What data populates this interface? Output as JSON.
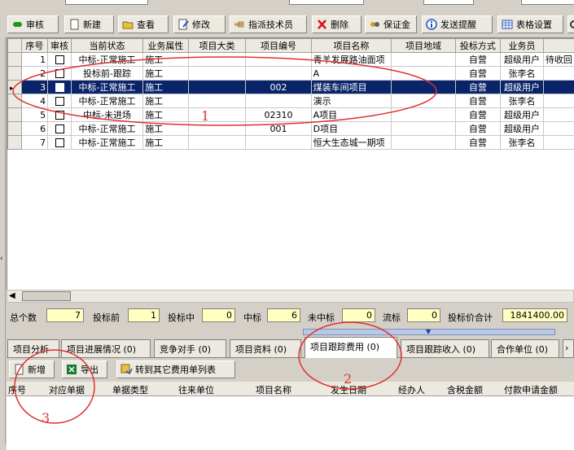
{
  "toolbar": [
    {
      "name": "audit-button",
      "label": "审核",
      "icon": "green-pill-icon"
    },
    {
      "name": "new-button",
      "label": "新建",
      "icon": "new-document-icon"
    },
    {
      "name": "view-button",
      "label": "查看",
      "icon": "folder-open-icon"
    },
    {
      "name": "edit-button",
      "label": "修改",
      "icon": "edit-document-icon"
    },
    {
      "name": "assign-tech-button",
      "label": "指派技术员",
      "icon": "pointing-hand-icon"
    },
    {
      "name": "delete-button",
      "label": "删除",
      "icon": "red-x-icon"
    },
    {
      "name": "deposit-button",
      "label": "保证金",
      "icon": "deposit-icon"
    },
    {
      "name": "send-reminder-button",
      "label": "发送提醒",
      "icon": "info-icon"
    },
    {
      "name": "table-settings-button",
      "label": "表格设置",
      "icon": "table-icon"
    }
  ],
  "grid": {
    "headers": [
      "序号",
      "审核",
      "当前状态",
      "业务属性",
      "项目大类",
      "项目编号",
      "项目名称",
      "项目地域",
      "投标方式",
      "业务员",
      ""
    ],
    "rows": [
      {
        "no": "1",
        "status": "中标-正常施工",
        "attr": "施工",
        "category": "",
        "code": "",
        "name": "青羊发展路油面项",
        "region": "",
        "method": "自营",
        "staff": "超级用户",
        "extra": "待收回"
      },
      {
        "no": "2",
        "status": "投标前-跟踪",
        "attr": "施工",
        "category": "",
        "code": "",
        "name": "A",
        "region": "",
        "method": "自营",
        "staff": "张李名",
        "extra": ""
      },
      {
        "no": "3",
        "status": "中标-正常施工",
        "attr": "施工",
        "category": "",
        "code": "002",
        "name": "煤装车间项目",
        "region": "",
        "method": "自营",
        "staff": "超级用户",
        "extra": ""
      },
      {
        "no": "4",
        "status": "中标-正常施工",
        "attr": "施工",
        "category": "",
        "code": "",
        "name": "演示",
        "region": "",
        "method": "自营",
        "staff": "张李名",
        "extra": ""
      },
      {
        "no": "5",
        "status": "中标-未进场",
        "attr": "施工",
        "category": "",
        "code": "02310",
        "name": "A项目",
        "region": "",
        "method": "自营",
        "staff": "超级用户",
        "extra": ""
      },
      {
        "no": "6",
        "status": "中标-正常施工",
        "attr": "施工",
        "category": "",
        "code": "001",
        "name": "D项目",
        "region": "",
        "method": "自营",
        "staff": "超级用户",
        "extra": ""
      },
      {
        "no": "7",
        "status": "中标-正常施工",
        "attr": "施工",
        "category": "",
        "code": "",
        "name": "恒大生态城一期项",
        "region": "",
        "method": "自营",
        "staff": "张李名",
        "extra": ""
      }
    ],
    "selected_row": 3
  },
  "stats": {
    "total_label": "总个数",
    "total": "7",
    "before_label": "投标前",
    "before": "1",
    "during_label": "投标中",
    "during": "0",
    "won_label": "中标",
    "won": "6",
    "lost_label": "未中标",
    "lost": "0",
    "failed_label": "流标",
    "failed": "0",
    "price_label": "投标价合计",
    "price": "1841400.00"
  },
  "tabs": [
    {
      "name": "tab-project-analysis",
      "label": "项目分析"
    },
    {
      "name": "tab-progress",
      "label": "项目进展情况 (0)"
    },
    {
      "name": "tab-competitors",
      "label": "竞争对手 (0)"
    },
    {
      "name": "tab-materials",
      "label": "项目资料 (0)"
    },
    {
      "name": "tab-tracking-cost",
      "label": "项目跟踪费用 (0)"
    },
    {
      "name": "tab-tracking-income",
      "label": "项目跟踪收入 (0)"
    },
    {
      "name": "tab-partners",
      "label": "合作单位 (0)"
    }
  ],
  "subtoolbar": {
    "add": "新增",
    "export": "导出",
    "transfer": "转到其它费用单列表"
  },
  "subgrid_headers": [
    "序号",
    "对应单据",
    "单据类型",
    "往来单位",
    "项目名称",
    "发生日期",
    "经办人",
    "含税金额",
    "付款申请金额"
  ],
  "annotations": [
    "1",
    "2",
    "3"
  ],
  "colors": {
    "selection": "#0a246a",
    "annotation": "#e03030",
    "stat_bg": "#ffffc0"
  }
}
